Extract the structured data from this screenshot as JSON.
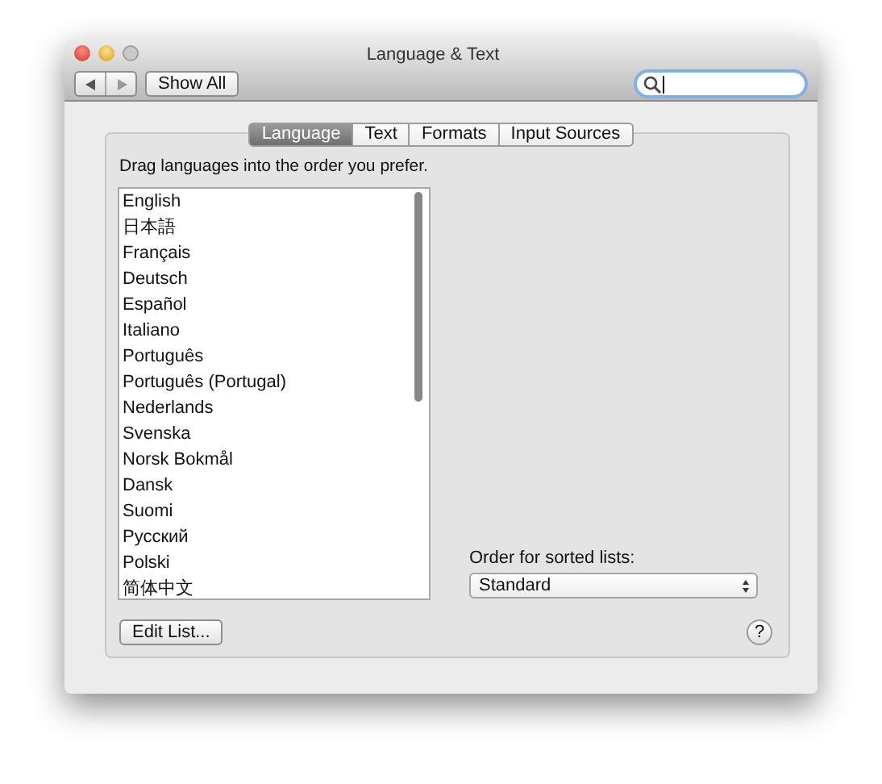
{
  "window": {
    "title": "Language & Text"
  },
  "toolbar": {
    "show_all": "Show All"
  },
  "tabs": [
    {
      "label": "Language",
      "selected": true
    },
    {
      "label": "Text",
      "selected": false
    },
    {
      "label": "Formats",
      "selected": false
    },
    {
      "label": "Input Sources",
      "selected": false
    }
  ],
  "instruction": "Drag languages into the order you prefer.",
  "languages": [
    "English",
    "日本語",
    "Français",
    "Deutsch",
    "Español",
    "Italiano",
    "Português",
    "Português (Portugal)",
    "Nederlands",
    "Svenska",
    "Norsk Bokmål",
    "Dansk",
    "Suomi",
    "Русский",
    "Polski",
    "简体中文"
  ],
  "sort_order": {
    "label": "Order for sorted lists:",
    "value": "Standard"
  },
  "edit_button": "Edit List...",
  "help_button": "?"
}
